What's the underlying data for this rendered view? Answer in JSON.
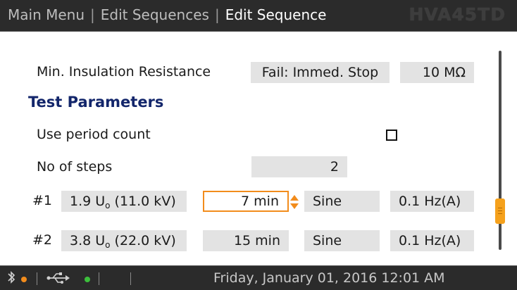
{
  "titlebar": {
    "crumb_1": "Main Menu",
    "crumb_2": "Edit Sequences",
    "crumb_3": "Edit Sequence",
    "separator": "|",
    "brand": "HVA45TD"
  },
  "insulation": {
    "label": "Min. Insulation Resistance",
    "action": "Fail: Immed. Stop",
    "value": "10 MΩ"
  },
  "test_parameters": {
    "heading": "Test Parameters",
    "use_period_count_label": "Use period count",
    "use_period_count_checked": false,
    "steps_label": "No of steps",
    "steps_value": "2"
  },
  "steps": [
    {
      "index": "#1",
      "voltage_factor": "1.9 U",
      "voltage_sub": "o",
      "voltage_kv": " (11.0 kV)",
      "duration": "7 min",
      "waveform": "Sine",
      "frequency": "0.1 Hz(A)"
    },
    {
      "index": "#2",
      "voltage_factor": "3.8 U",
      "voltage_sub": "o",
      "voltage_kv": " (22.0 kV)",
      "duration": "15 min",
      "waveform": "Sine",
      "frequency": "0.1 Hz(A)"
    }
  ],
  "statusbar": {
    "bluetooth_icon": "bluetooth-icon",
    "usb_icon": "usb-icon",
    "datetime": "Friday, January 01, 2016 12:01 AM",
    "dot_orange": "#f28c1c",
    "dot_green": "#3cbf3c"
  },
  "colors": {
    "accent": "#f28c1c",
    "heading": "#13266b",
    "field_bg": "#e3e3e3",
    "bar_bg": "#2b2b2b"
  }
}
